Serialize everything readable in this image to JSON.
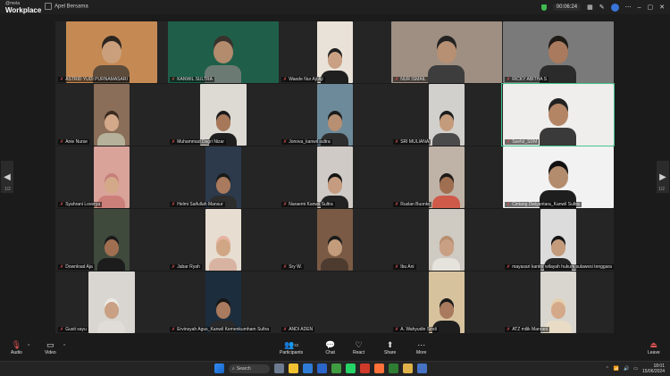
{
  "app": {
    "logo_small": "@meta",
    "logo_big": "Workplace",
    "meeting_title": "Apel Bersama",
    "timer": "00:06:24"
  },
  "tiles": [
    {
      "name": "ASTRID YUDI PURNAMASARI",
      "bg": "#c58a54",
      "skin": "#caa07c",
      "shirt": "#5c4b3b",
      "head": "#2d2620"
    },
    {
      "name": "KANWIL SULTRA",
      "bg": "#1f5f4a",
      "skin": "#b38b6d",
      "shirt": "#6c7a74",
      "head": "#39322c"
    },
    {
      "name": "Waode Nur Aji Aji",
      "bg": "#e9e2d8",
      "skin": "#c9a083",
      "shirt": "#1f1f1f",
      "head": "#1f1f1f"
    },
    {
      "name": "NUR ISMAIL",
      "bg": "#9e8f82",
      "skin": "#b78f73",
      "shirt": "#3d3d3d",
      "head": "#222"
    },
    {
      "name": "RICKY ABITHA S",
      "bg": "#7a7a7a",
      "skin": "#a97a5d",
      "shirt": "#2b2b2b",
      "head": "#1e1a16"
    },
    {
      "name": "Anie Nurse",
      "bg": "#8a6e59",
      "skin": "#d3a98a",
      "shirt": "#b5b19a",
      "head": "#3b2b21"
    },
    {
      "name": "Muhammad Dagri Nizar",
      "bg": "#ddd9d3",
      "skin": "#a67759",
      "shirt": "#1e1e1e",
      "head": "#1a1a1a"
    },
    {
      "name": "Jonova_kanwil sultra",
      "bg": "#6c8a9a",
      "skin": "#b78f73",
      "shirt": "#2e2e2e",
      "head": "#1b1b1b"
    },
    {
      "name": "SRI MULIANA",
      "bg": "#d2d0cc",
      "skin": "#c49b7b",
      "shirt": "#4a4a4a",
      "head": "#1c1c1c"
    },
    {
      "name": "Saeful_SDM",
      "bg": "#efeeec",
      "skin": "#b48565",
      "shirt": "#3a3a3a",
      "head": "#222"
    },
    {
      "name": "Syahrani Loverya",
      "bg": "#d9a39a",
      "skin": "#d3a98a",
      "shirt": "#cc7f78",
      "head": "#c67f79"
    },
    {
      "name": "Helmi Saifullah Mansur",
      "bg": "#2c3a4b",
      "skin": "#a97a5d",
      "shirt": "#2d2d2d",
      "head": "#1a1a1a"
    },
    {
      "name": "Naraemi Kanwil Sultra",
      "bg": "#cfcac6",
      "skin": "#c59c7f",
      "shirt": "#222",
      "head": "#151515"
    },
    {
      "name": "Ruslan Buonte",
      "bg": "#bfb3a7",
      "skin": "#a06f51",
      "shirt": "#cf5a4a",
      "head": "#1e1a17"
    },
    {
      "name": "Cintang Dwiyantara_Kanwil Sultra",
      "bg": "#f2f2f2",
      "skin": "#b38b6d",
      "shirt": "#1e1e1e",
      "head": "#111"
    },
    {
      "name": "Download Aja",
      "bg": "#3f4a3d",
      "skin": "#a06f51",
      "shirt": "#1c1c1c",
      "head": "#1b1b1b"
    },
    {
      "name": "Jabar Ryah",
      "bg": "#e7ddd1",
      "skin": "#d0a684",
      "shirt": "#d9b3a2",
      "head": "#e7b2a1"
    },
    {
      "name": "Sry W.",
      "bg": "#7a5a44",
      "skin": "#c39c7c",
      "shirt": "#4d3b30",
      "head": "#1b1b1b"
    },
    {
      "name": "Ibu Ani",
      "bg": "#cfcac2",
      "skin": "#c9a083",
      "shirt": "#e6e3dd",
      "head": "#b68f6f"
    },
    {
      "name": "mayasari kantor wilayah hukum sulawesi tenggara",
      "bg": "#dcdcdc",
      "skin": "#c49b7b",
      "shirt": "#252525",
      "head": "#141414"
    },
    {
      "name": "Gusti sayu",
      "bg": "#d9d6d1",
      "skin": "#c9a083",
      "shirt": "#e0ddd8",
      "head": "#ece9e4"
    },
    {
      "name": "Ervinsyah Agus_Kanwil Kemenkumham Sultra",
      "bg": "#1c2d3d",
      "skin": "#a97a5d",
      "shirt": "#2a2a2a",
      "head": "#161616"
    },
    {
      "name": "ANDI ADEN",
      "bg": "#252525",
      "skin": "#252525",
      "shirt": "#252525",
      "head": "#252525"
    },
    {
      "name": "A. Wahyudin Sindi",
      "bg": "#d7c29e",
      "skin": "#a97a5d",
      "shirt": "#1e1e1e",
      "head": "#1a1a1a"
    },
    {
      "name": "ATZ milik Manrani",
      "bg": "#d9d6cf",
      "skin": "#d3a98a",
      "shirt": "#e8dcc6",
      "head": "#e4cfae"
    }
  ],
  "nav": {
    "left_arrow": "◀",
    "right_arrow": "▶",
    "page_left": "1/2",
    "page_right": "1/2"
  },
  "controls": {
    "audio": "Audio",
    "video": "Video",
    "participants": "Participants",
    "participants_count": "33",
    "chat": "Chat",
    "react": "React",
    "share": "Share",
    "more": "More",
    "leave": "Leave"
  },
  "taskbar": {
    "search": "Search",
    "time": "18:01",
    "date": "15/06/2024"
  }
}
